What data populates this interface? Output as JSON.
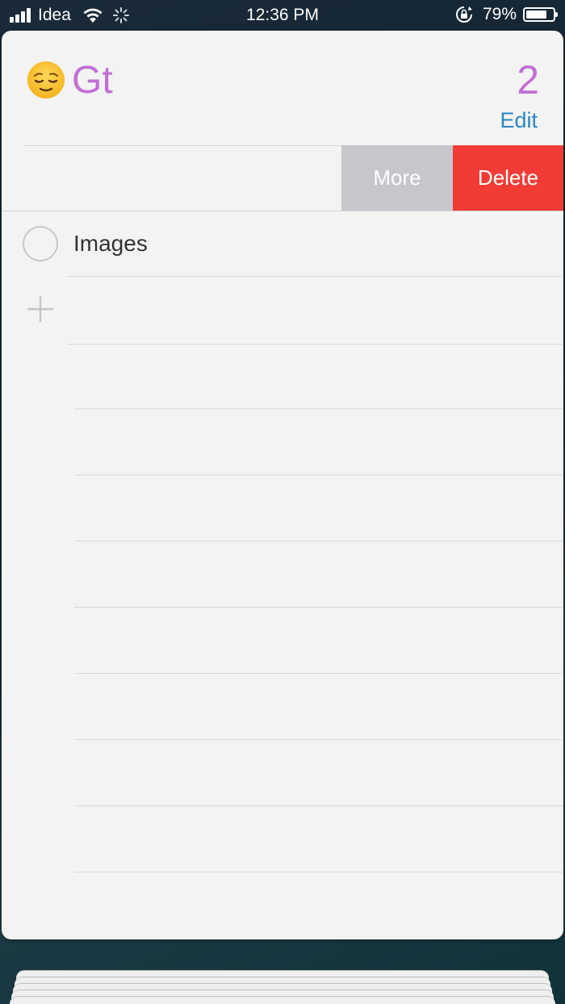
{
  "status_bar": {
    "carrier": "Idea",
    "time": "12:36 PM",
    "battery_percent": "79%",
    "battery_level": 0.79,
    "icons": [
      "signal-icon",
      "wifi-icon",
      "activity-spinner-icon",
      "rotation-lock-icon",
      "battery-icon"
    ]
  },
  "list": {
    "emoji": "relieved-face-emoji",
    "title": "Gt",
    "count": "2",
    "edit_label": "Edit",
    "accent_color": "#c16fd4",
    "edit_color": "#2a86c5"
  },
  "swipe_actions": {
    "more_label": "More",
    "delete_label": "Delete",
    "more_color": "#c6c6cc",
    "delete_color": "#f33b36"
  },
  "items": [
    {
      "text": "Images",
      "completed": false
    }
  ],
  "add_icon": "plus-icon"
}
